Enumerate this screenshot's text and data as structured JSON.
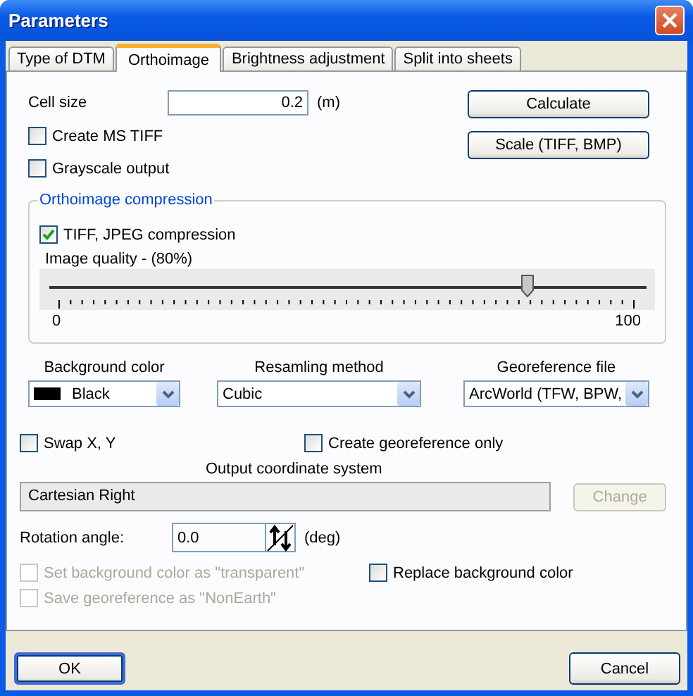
{
  "window": {
    "title": "Parameters"
  },
  "tabs": [
    {
      "label": "Type of DTM",
      "selected": false
    },
    {
      "label": "Orthoimage",
      "selected": true
    },
    {
      "label": "Brightness adjustment",
      "selected": false
    },
    {
      "label": "Split into sheets",
      "selected": false
    }
  ],
  "cell_size": {
    "label": "Cell size",
    "value": "0.2",
    "unit": "(m)"
  },
  "side_buttons": [
    {
      "label": "Calculate"
    },
    {
      "label": "Scale (TIFF, BMP)"
    }
  ],
  "options": [
    {
      "label": "Create MS TIFF",
      "checked": false
    },
    {
      "label": "Grayscale output",
      "checked": false
    }
  ],
  "compression": {
    "title": "Orthoimage compression",
    "jpeg": {
      "label": "TIFF, JPEG compression",
      "checked": true
    },
    "quality": {
      "label": "Image quality - (80%)",
      "level": 0.8,
      "min": "0",
      "max": "100"
    }
  },
  "dropdowns": [
    {
      "label": "Background color",
      "value": "Black",
      "kind": "color",
      "color": "#000000"
    },
    {
      "label": "Resamling method",
      "value": "Cubic",
      "kind": "plain"
    },
    {
      "label": "Georeference file",
      "value": "ArcWorld (TFW, BPW,",
      "kind": "plain"
    }
  ],
  "swap_options": [
    {
      "label": "Swap X, Y",
      "checked": false
    },
    {
      "label": "Create georeference only",
      "checked": false
    }
  ],
  "coordinate_system": {
    "label": "Output coordinate system",
    "value": "Cartesian Right",
    "button": {
      "label": "Change",
      "disabled": true
    }
  },
  "rotation": {
    "label": "Rotation angle:",
    "value": "0.0",
    "unit": "(deg)"
  },
  "extra_options": [
    {
      "label": "Set background color as \"transparent\"",
      "checked": false,
      "disabled": true
    },
    {
      "label": "Replace background color",
      "checked": false,
      "disabled": false
    },
    {
      "label": "Save georeference as \"NonEarth\"",
      "checked": false,
      "disabled": true
    }
  ],
  "footer": [
    {
      "label": "OK",
      "default": true
    },
    {
      "label": "Cancel",
      "default": false
    }
  ]
}
